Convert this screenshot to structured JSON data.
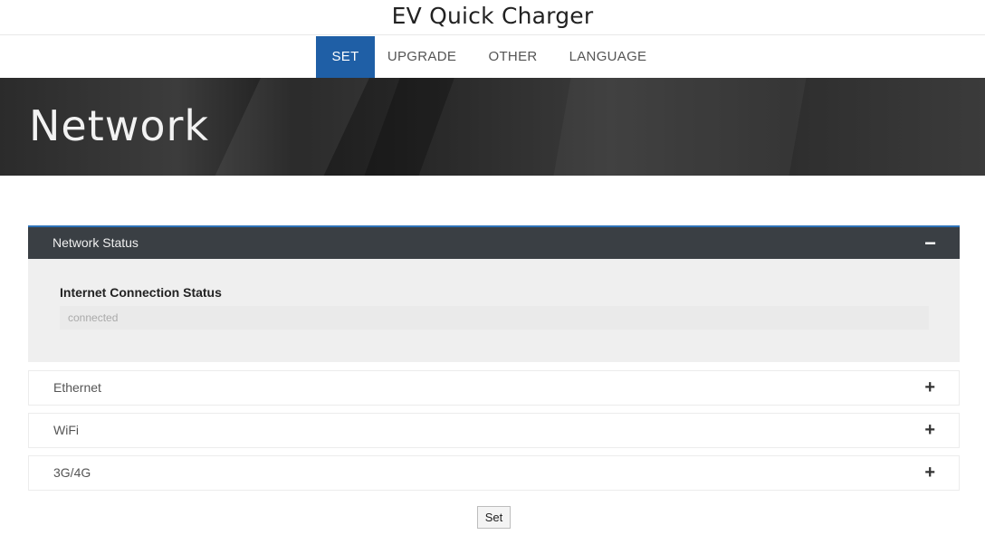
{
  "app": {
    "title": "EV Quick Charger"
  },
  "nav": {
    "tabs": [
      {
        "label": "SET",
        "active": true
      },
      {
        "label": "UPGRADE",
        "active": false
      },
      {
        "label": "OTHER",
        "active": false
      },
      {
        "label": "LANGUAGE",
        "active": false
      }
    ]
  },
  "hero": {
    "title": "Network"
  },
  "panels": [
    {
      "title": "Network Status",
      "expanded": true,
      "toggle": "−",
      "fields": [
        {
          "label": "Internet Connection Status",
          "value": "connected"
        }
      ]
    },
    {
      "title": "Ethernet",
      "expanded": false,
      "toggle": "+"
    },
    {
      "title": "WiFi",
      "expanded": false,
      "toggle": "+"
    },
    {
      "title": "3G/4G",
      "expanded": false,
      "toggle": "+"
    }
  ],
  "actions": {
    "set_label": "Set"
  },
  "colors": {
    "accent": "#1f5fa6",
    "panel_header": "#3a3f44",
    "panel_body": "#efefef"
  }
}
